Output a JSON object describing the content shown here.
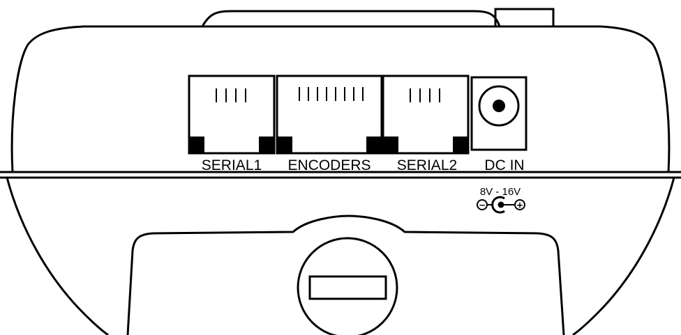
{
  "ports": {
    "serial1": "SERIAL1",
    "encoders": "ENCODERS",
    "serial2": "SERIAL2",
    "dc_in": "DC IN"
  },
  "power": {
    "voltage_range": "8V - 16V",
    "negative_symbol": "−",
    "positive_symbol": "+"
  }
}
